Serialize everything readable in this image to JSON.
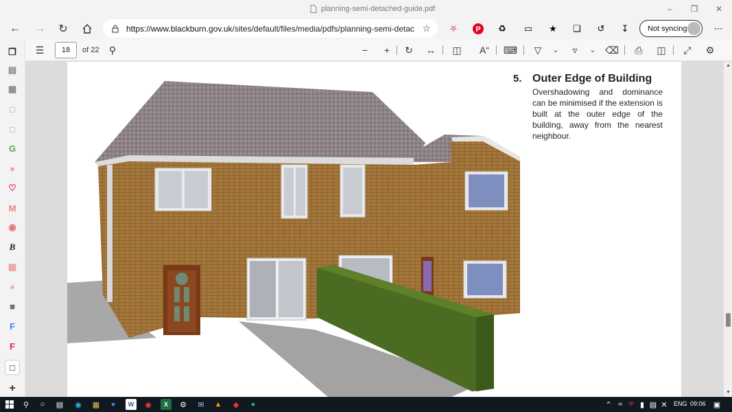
{
  "window": {
    "title": "planning-semi-detached-guide.pdf"
  },
  "address_bar": {
    "url_host": "https://www.blackburn.gov.uk",
    "url_path": "/sites/default/files/media/pdfs/planning-semi-detach..."
  },
  "profile": {
    "sync_label": "Not syncing"
  },
  "pdf_toolbar": {
    "page_number": "18",
    "page_count": "of 22"
  },
  "document": {
    "item_number": "5.",
    "heading": "Outer Edge of Building",
    "body": "Overshadowing and dominance can be minimised if the extension is built at the outer edge of the building, away from the nearest neighbour."
  },
  "taskbar": {
    "language": "ENG",
    "time": "09:06"
  },
  "colors": {
    "accent": "#0078d4",
    "pinterest": "#e60023",
    "notification_badge": "#d13438"
  }
}
